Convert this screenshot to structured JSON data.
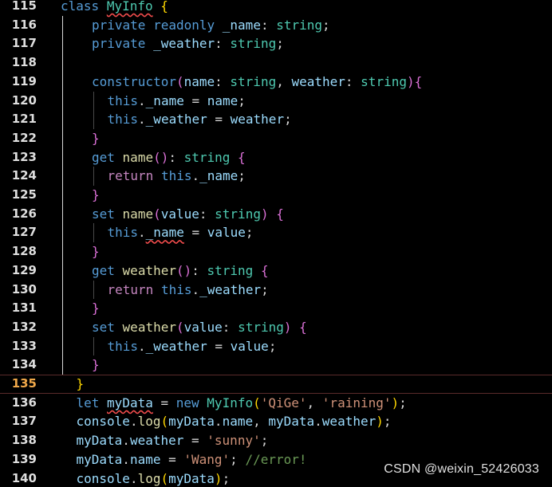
{
  "watermark": "CSDN @weixin_52426033",
  "current_line": 135,
  "lines": [
    {
      "num": "115",
      "indent": 0,
      "tokens": [
        [
          "class",
          "kw"
        ],
        [
          " ",
          "pun"
        ],
        [
          "MyInfo",
          "type",
          "err"
        ],
        [
          " ",
          "pun"
        ],
        [
          "{",
          "b1"
        ]
      ]
    },
    {
      "num": "116",
      "indent": 2,
      "tokens": [
        [
          "private",
          "kw"
        ],
        [
          " ",
          "pun"
        ],
        [
          "readonly",
          "kw"
        ],
        [
          " ",
          "pun"
        ],
        [
          "_name",
          "id"
        ],
        [
          ": ",
          "pun"
        ],
        [
          "string",
          "type"
        ],
        [
          ";",
          "pun"
        ]
      ]
    },
    {
      "num": "117",
      "indent": 2,
      "tokens": [
        [
          "private",
          "kw"
        ],
        [
          " ",
          "pun"
        ],
        [
          "_weather",
          "id"
        ],
        [
          ": ",
          "pun"
        ],
        [
          "string",
          "type"
        ],
        [
          ";",
          "pun"
        ]
      ]
    },
    {
      "num": "118",
      "indent": 0,
      "tokens": []
    },
    {
      "num": "119",
      "indent": 2,
      "tokens": [
        [
          "constructor",
          "kw"
        ],
        [
          "(",
          "b2"
        ],
        [
          "name",
          "id"
        ],
        [
          ": ",
          "pun"
        ],
        [
          "string",
          "type"
        ],
        [
          ", ",
          "pun"
        ],
        [
          "weather",
          "id"
        ],
        [
          ": ",
          "pun"
        ],
        [
          "string",
          "type"
        ],
        [
          ")",
          "b2"
        ],
        [
          "{",
          "b2"
        ]
      ]
    },
    {
      "num": "120",
      "indent": 3,
      "tokens": [
        [
          "this",
          "kw"
        ],
        [
          ".",
          "pun"
        ],
        [
          "_name",
          "id"
        ],
        [
          " = ",
          "pun"
        ],
        [
          "name",
          "id"
        ],
        [
          ";",
          "pun"
        ]
      ]
    },
    {
      "num": "121",
      "indent": 3,
      "tokens": [
        [
          "this",
          "kw"
        ],
        [
          ".",
          "pun"
        ],
        [
          "_weather",
          "id"
        ],
        [
          " = ",
          "pun"
        ],
        [
          "weather",
          "id"
        ],
        [
          ";",
          "pun"
        ]
      ]
    },
    {
      "num": "122",
      "indent": 2,
      "tokens": [
        [
          "}",
          "b2"
        ]
      ]
    },
    {
      "num": "123",
      "indent": 2,
      "tokens": [
        [
          "get",
          "kw"
        ],
        [
          " ",
          "pun"
        ],
        [
          "name",
          "fn"
        ],
        [
          "()",
          "b2"
        ],
        [
          ": ",
          "pun"
        ],
        [
          "string",
          "type"
        ],
        [
          " ",
          "pun"
        ],
        [
          "{",
          "b2"
        ]
      ]
    },
    {
      "num": "124",
      "indent": 3,
      "tokens": [
        [
          "return",
          "ctrl"
        ],
        [
          " ",
          "pun"
        ],
        [
          "this",
          "kw"
        ],
        [
          ".",
          "pun"
        ],
        [
          "_name",
          "id"
        ],
        [
          ";",
          "pun"
        ]
      ]
    },
    {
      "num": "125",
      "indent": 2,
      "tokens": [
        [
          "}",
          "b2"
        ]
      ]
    },
    {
      "num": "126",
      "indent": 2,
      "tokens": [
        [
          "set",
          "kw"
        ],
        [
          " ",
          "pun"
        ],
        [
          "name",
          "fn"
        ],
        [
          "(",
          "b2"
        ],
        [
          "value",
          "id"
        ],
        [
          ": ",
          "pun"
        ],
        [
          "string",
          "type"
        ],
        [
          ")",
          "b2"
        ],
        [
          " ",
          "pun"
        ],
        [
          "{",
          "b2"
        ]
      ]
    },
    {
      "num": "127",
      "indent": 3,
      "tokens": [
        [
          "this",
          "kw"
        ],
        [
          ".",
          "pun"
        ],
        [
          "_name",
          "id",
          "err"
        ],
        [
          " = ",
          "pun"
        ],
        [
          "value",
          "id"
        ],
        [
          ";",
          "pun"
        ]
      ]
    },
    {
      "num": "128",
      "indent": 2,
      "tokens": [
        [
          "}",
          "b2"
        ]
      ]
    },
    {
      "num": "129",
      "indent": 2,
      "tokens": [
        [
          "get",
          "kw"
        ],
        [
          " ",
          "pun"
        ],
        [
          "weather",
          "fn"
        ],
        [
          "()",
          "b2"
        ],
        [
          ": ",
          "pun"
        ],
        [
          "string",
          "type"
        ],
        [
          " ",
          "pun"
        ],
        [
          "{",
          "b2"
        ]
      ]
    },
    {
      "num": "130",
      "indent": 3,
      "tokens": [
        [
          "return",
          "ctrl"
        ],
        [
          " ",
          "pun"
        ],
        [
          "this",
          "kw"
        ],
        [
          ".",
          "pun"
        ],
        [
          "_weather",
          "id"
        ],
        [
          ";",
          "pun"
        ]
      ]
    },
    {
      "num": "131",
      "indent": 2,
      "tokens": [
        [
          "}",
          "b2"
        ]
      ]
    },
    {
      "num": "132",
      "indent": 2,
      "tokens": [
        [
          "set",
          "kw"
        ],
        [
          " ",
          "pun"
        ],
        [
          "weather",
          "fn"
        ],
        [
          "(",
          "b2"
        ],
        [
          "value",
          "id"
        ],
        [
          ": ",
          "pun"
        ],
        [
          "string",
          "type"
        ],
        [
          ")",
          "b2"
        ],
        [
          " ",
          "pun"
        ],
        [
          "{",
          "b2"
        ]
      ]
    },
    {
      "num": "133",
      "indent": 3,
      "tokens": [
        [
          "this",
          "kw"
        ],
        [
          ".",
          "pun"
        ],
        [
          "_weather",
          "id"
        ],
        [
          " = ",
          "pun"
        ],
        [
          "value",
          "id"
        ],
        [
          ";",
          "pun"
        ]
      ]
    },
    {
      "num": "134",
      "indent": 2,
      "tokens": [
        [
          "}",
          "b2"
        ]
      ]
    },
    {
      "num": "135",
      "indent": 1,
      "tokens": [
        [
          "}",
          "b1"
        ]
      ]
    },
    {
      "num": "136",
      "indent": 1,
      "tokens": [
        [
          "let",
          "kw"
        ],
        [
          " ",
          "pun"
        ],
        [
          "myData",
          "id",
          "err"
        ],
        [
          " = ",
          "pun"
        ],
        [
          "new",
          "kw"
        ],
        [
          " ",
          "pun"
        ],
        [
          "MyInfo",
          "type"
        ],
        [
          "(",
          "b1"
        ],
        [
          "'QiGe'",
          "str"
        ],
        [
          ", ",
          "pun"
        ],
        [
          "'raining'",
          "str"
        ],
        [
          ")",
          "b1"
        ],
        [
          ";",
          "pun"
        ]
      ]
    },
    {
      "num": "137",
      "indent": 1,
      "tokens": [
        [
          "console",
          "id"
        ],
        [
          ".",
          "pun"
        ],
        [
          "log",
          "fn"
        ],
        [
          "(",
          "b1"
        ],
        [
          "myData",
          "id"
        ],
        [
          ".",
          "pun"
        ],
        [
          "name",
          "id"
        ],
        [
          ", ",
          "pun"
        ],
        [
          "myData",
          "id"
        ],
        [
          ".",
          "pun"
        ],
        [
          "weather",
          "id"
        ],
        [
          ")",
          "b1"
        ],
        [
          ";",
          "pun"
        ]
      ]
    },
    {
      "num": "138",
      "indent": 1,
      "tokens": [
        [
          "myData",
          "id"
        ],
        [
          ".",
          "pun"
        ],
        [
          "weather",
          "id"
        ],
        [
          " = ",
          "pun"
        ],
        [
          "'sunny'",
          "str"
        ],
        [
          ";",
          "pun"
        ]
      ]
    },
    {
      "num": "139",
      "indent": 1,
      "tokens": [
        [
          "myData",
          "id"
        ],
        [
          ".",
          "pun"
        ],
        [
          "name",
          "id"
        ],
        [
          " = ",
          "pun"
        ],
        [
          "'Wang'",
          "str"
        ],
        [
          "; ",
          "pun"
        ],
        [
          "//error!",
          "cmt"
        ]
      ]
    },
    {
      "num": "140",
      "indent": 1,
      "tokens": [
        [
          "console",
          "id"
        ],
        [
          ".",
          "pun"
        ],
        [
          "log",
          "fn"
        ],
        [
          "(",
          "b1"
        ],
        [
          "myData",
          "id"
        ],
        [
          ")",
          "b1"
        ],
        [
          ";",
          "pun"
        ]
      ]
    }
  ]
}
